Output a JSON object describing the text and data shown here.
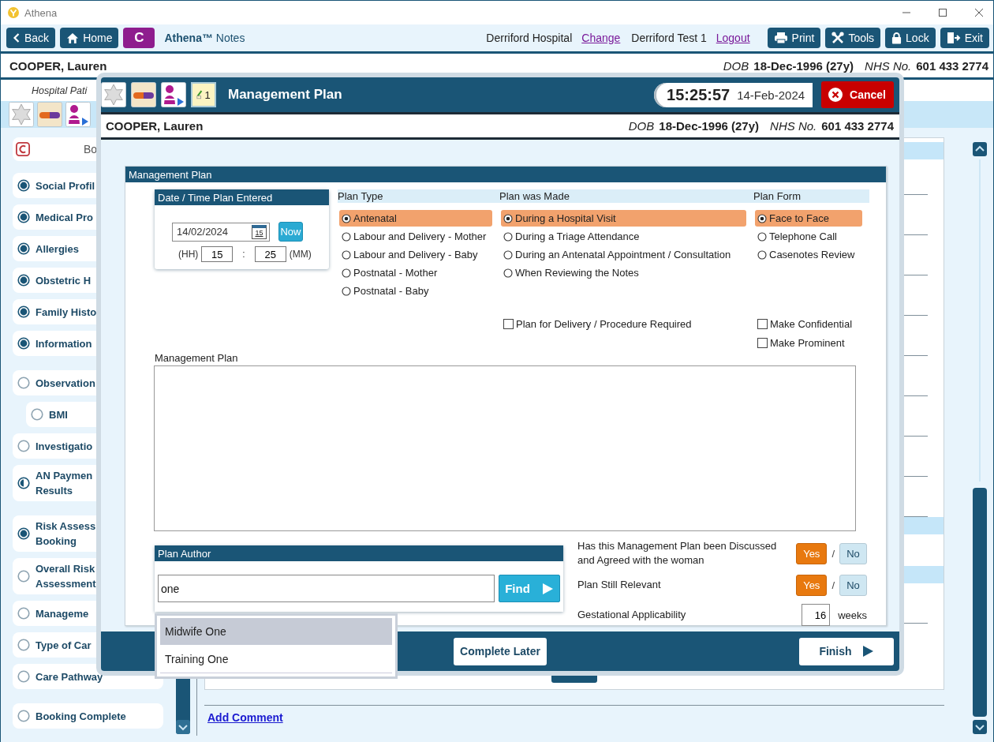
{
  "window": {
    "title": "Athena"
  },
  "toolbar": {
    "nav_buttons": [
      {
        "kind": "back",
        "label": "Back"
      },
      {
        "kind": "home",
        "label": "Home"
      },
      {
        "kind": "letter",
        "label": "C"
      }
    ],
    "app_title": "**Athena™** Notes",
    "site": "Derriford Hospital",
    "site_link": "Change",
    "user": "Derriford Test 1",
    "user_link": "Logout",
    "tool_buttons": [
      {
        "kind": "print",
        "label": "Print"
      },
      {
        "kind": "tools",
        "label": "Tools"
      },
      {
        "kind": "lock",
        "label": "Lock"
      },
      {
        "kind": "exit",
        "label": "Exit"
      }
    ]
  },
  "patient": {
    "name": "COOPER, Lauren",
    "dob_label": "DOB",
    "dob": "18-Dec-1996 (27y)",
    "nhs_label": "NHS No.",
    "nhs": "601 433 2774"
  },
  "subheader": {
    "text": "Hospital Pati"
  },
  "icon_row": [
    {
      "kind": "flower"
    },
    {
      "kind": "pill"
    },
    {
      "kind": "person"
    }
  ],
  "sidebar": {
    "header": "Bo",
    "items": [
      {
        "kind": "complete",
        "label": "Social Profil"
      },
      {
        "kind": "complete",
        "label": "Medical Pro"
      },
      {
        "kind": "complete",
        "label": "Allergies"
      },
      {
        "kind": "complete",
        "label": "Obstetric H"
      },
      {
        "kind": "complete",
        "label": "Family Histo"
      },
      {
        "kind": "complete",
        "label": "Information"
      },
      {
        "kind": "empty",
        "label": "Observation",
        "children": [
          {
            "kind": "empty",
            "label": "BMI"
          }
        ]
      },
      {
        "kind": "empty",
        "label": "Investigatio"
      },
      {
        "kind": "partial",
        "label": "AN Paymen\nResults"
      },
      {
        "kind": "complete",
        "label": "Risk Assess\nBooking"
      },
      {
        "kind": "empty",
        "label": "Overall Risk\nAssessment"
      },
      {
        "kind": "empty",
        "label": "Manageme"
      },
      {
        "kind": "empty",
        "label": "Type of Car"
      },
      {
        "kind": "empty",
        "label": "Care Pathway"
      },
      {
        "kind": "empty",
        "label": "Booking Complete"
      }
    ]
  },
  "main": {
    "link": "Add Comment"
  },
  "modal": {
    "icon_buttons": [
      {
        "kind": "flower"
      },
      {
        "kind": "pill"
      },
      {
        "kind": "person"
      },
      {
        "kind": "notes",
        "label": "1"
      }
    ],
    "title": "Management Plan",
    "time": "15:25:57",
    "date": "14-Feb-2024",
    "cancel": "Cancel",
    "patient": {
      "name": "COOPER, Lauren",
      "dob_label": "DOB",
      "dob": "18-Dec-1996 (27y)",
      "nhs_label": "NHS No.",
      "nhs": "601 433 2774"
    },
    "panel_title": "Management Plan",
    "datetime": {
      "title": "Date / Time Plan Entered",
      "date": "14/02/2024",
      "calendar_day": "15",
      "now": "Now",
      "hh_label": "(HH)",
      "hh": "15",
      "sep": ":",
      "mm": "25",
      "mm_label": "(MM)"
    },
    "groups": [
      {
        "title": "Plan Type",
        "options": [
          {
            "label": "Antenatal",
            "selected": true
          },
          {
            "label": "Labour and Delivery - Mother",
            "selected": false
          },
          {
            "label": "Labour and Delivery - Baby",
            "selected": false
          },
          {
            "label": "Postnatal - Mother",
            "selected": false
          },
          {
            "label": "Postnatal - Baby",
            "selected": false
          }
        ]
      },
      {
        "title": "Plan was Made",
        "options": [
          {
            "label": "During a Hospital Visit",
            "selected": true
          },
          {
            "label": "During a Triage Attendance",
            "selected": false
          },
          {
            "label": "During an Antenatal Appointment / Consultation",
            "selected": false
          },
          {
            "label": "When Reviewing the Notes",
            "selected": false
          }
        ],
        "checks": [
          {
            "label": "Plan for Delivery / Procedure Required",
            "checked": false
          }
        ]
      },
      {
        "title": "Plan Form",
        "options": [
          {
            "label": "Face to Face",
            "selected": true
          },
          {
            "label": "Telephone Call",
            "selected": false
          },
          {
            "label": "Casenotes Review",
            "selected": false
          }
        ],
        "checks": [
          {
            "label": "Make Confidential",
            "checked": false
          },
          {
            "label": "Make Prominent",
            "checked": false
          }
        ]
      }
    ],
    "plan_label": "Management Plan",
    "author": {
      "title": "Plan Author",
      "value": "one",
      "find": "Find",
      "suggestions": [
        {
          "label": "Midwife One",
          "selected": true
        },
        {
          "label": "Training One",
          "selected": false
        }
      ]
    },
    "questions": [
      {
        "kind": "choice",
        "label": "Has this Management Plan been Discussed and Agreed with the woman",
        "sep": "/",
        "options": [
          {
            "label": "Yes",
            "selected": true
          },
          {
            "label": "No",
            "selected": false
          }
        ]
      },
      {
        "kind": "choice",
        "label": "Plan Still Relevant",
        "sep": "/",
        "options": [
          {
            "label": "Yes",
            "selected": true
          },
          {
            "label": "No",
            "selected": false
          }
        ]
      },
      {
        "kind": "number",
        "label": "Gestational Applicability",
        "value": "16",
        "unit": "weeks"
      }
    ],
    "footer": {
      "later": "Complete Later",
      "finish": "Finish"
    }
  }
}
